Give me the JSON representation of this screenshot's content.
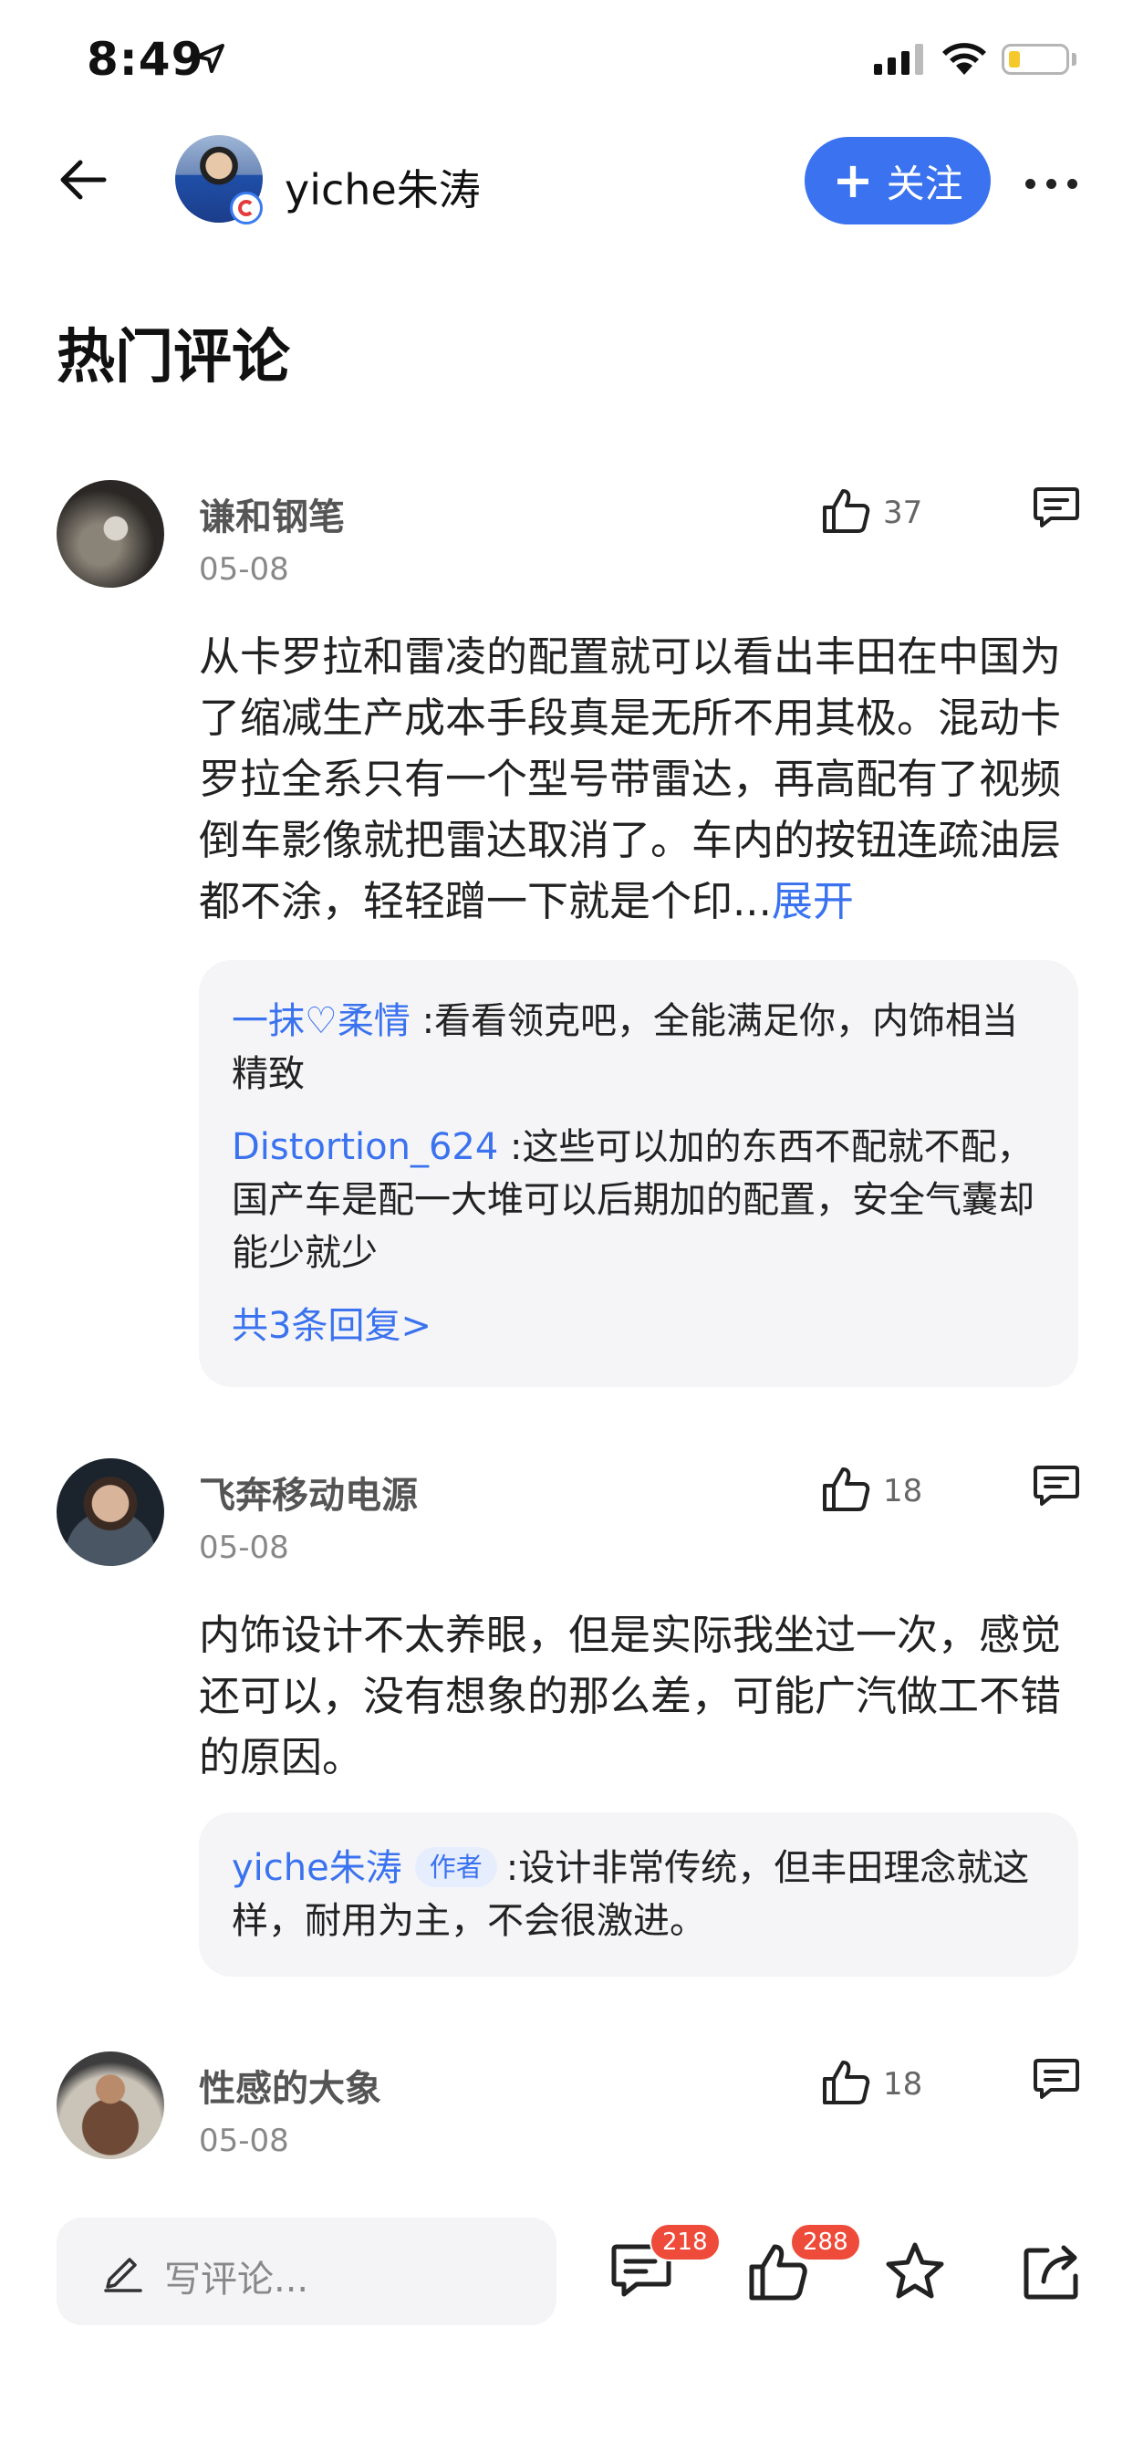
{
  "status_bar": {
    "time": "8:49",
    "battery_color": "#f5c92b"
  },
  "header": {
    "author_name": "yiche朱涛",
    "follow_label": "关注"
  },
  "section": {
    "title": "热门评论"
  },
  "comments": [
    {
      "user": "谦和钢笔",
      "date": "05-08",
      "likes": "37",
      "text": "从卡罗拉和雷凌的配置就可以看出丰田在中国为了缩减生产成本手段真是无所不用其极。混动卡罗拉全系只有一个型号带雷达，再高配有了视频倒车影像就把雷达取消了。车内的按钮连疏油层都不涂，轻轻蹭一下就是个印...",
      "expand_label": "展开",
      "replies": [
        {
          "user": "一抹♡柔情",
          "text": ":看看领克吧，全能满足你，内饰相当精致"
        },
        {
          "user": "Distortion_624",
          "text": ":这些可以加的东西不配就不配，国产车是配一大堆可以后期加的配置，安全气囊却能少就少"
        }
      ],
      "more_replies": "共3条回复>"
    },
    {
      "user": "飞奔移动电源",
      "date": "05-08",
      "likes": "18",
      "text": "内饰设计不太养眼，但是实际我坐过一次，感觉还可以，没有想象的那么差，可能广汽做工不错的原因。",
      "replies": [
        {
          "user": "yiche朱涛",
          "tag": "作者",
          "text": ":设计非常传统，但丰田理念就这样，耐用为主，不会很激进。"
        }
      ]
    },
    {
      "user": "性感的大象",
      "date": "05-08",
      "likes": "18"
    }
  ],
  "bottom_bar": {
    "input_placeholder": "写评论...",
    "comment_count": "218",
    "like_count": "288"
  },
  "colors": {
    "accent": "#3a72ef",
    "badge": "#ee4b3a"
  }
}
